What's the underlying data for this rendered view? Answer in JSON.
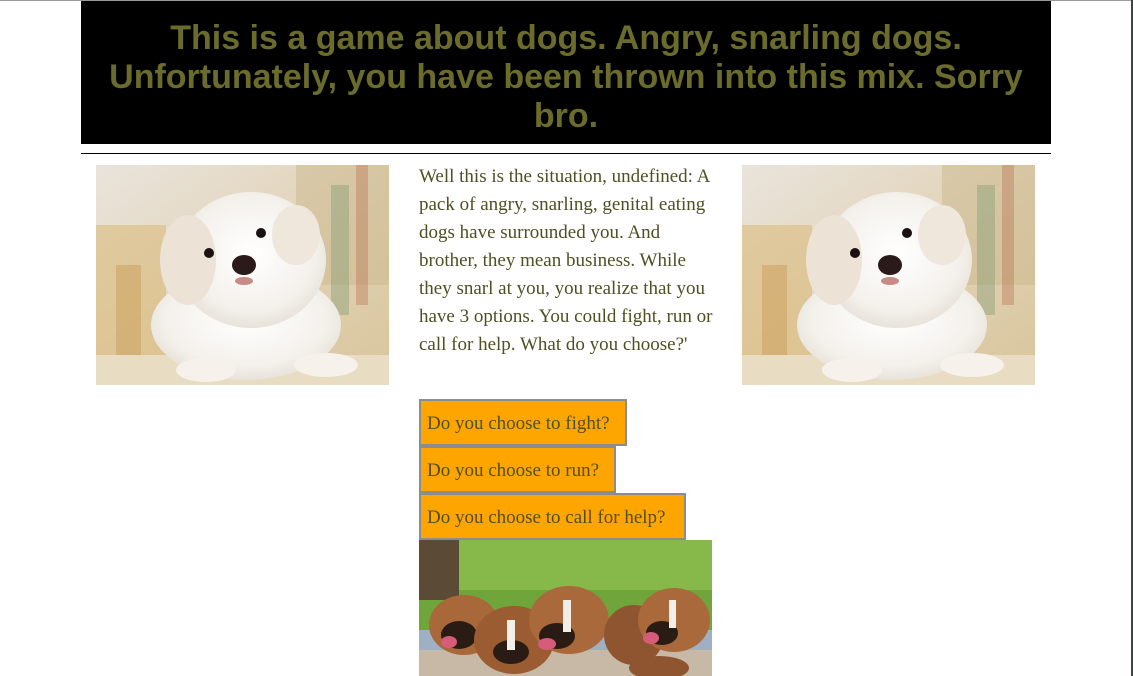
{
  "header": {
    "text": "This is a game about dogs. Angry, snarling dogs. Unfortunately, you have been thrown into this mix. Sorry bro."
  },
  "story": {
    "text": "Well this is the situation, undefined: A pack of angry, snarling, genital eating dogs have surrounded you. And brother, they mean business. While they snarl at you, you realize that you have 3 options. You could fight, run or call for help. What do you choose?'"
  },
  "choices": [
    {
      "label": "Do you choose to fight?"
    },
    {
      "label": "Do you choose to run?"
    },
    {
      "label": "Do you choose to call for help?"
    }
  ],
  "images": {
    "left": "white-puppy-photo",
    "right": "white-puppy-photo",
    "bottom": "boxer-puppies-photo"
  },
  "colors": {
    "header_bg": "#000000",
    "header_text": "#6b6b2b",
    "body_text": "#4f4f24",
    "button_bg": "#ffa500",
    "button_border": "#8c8c8c"
  }
}
